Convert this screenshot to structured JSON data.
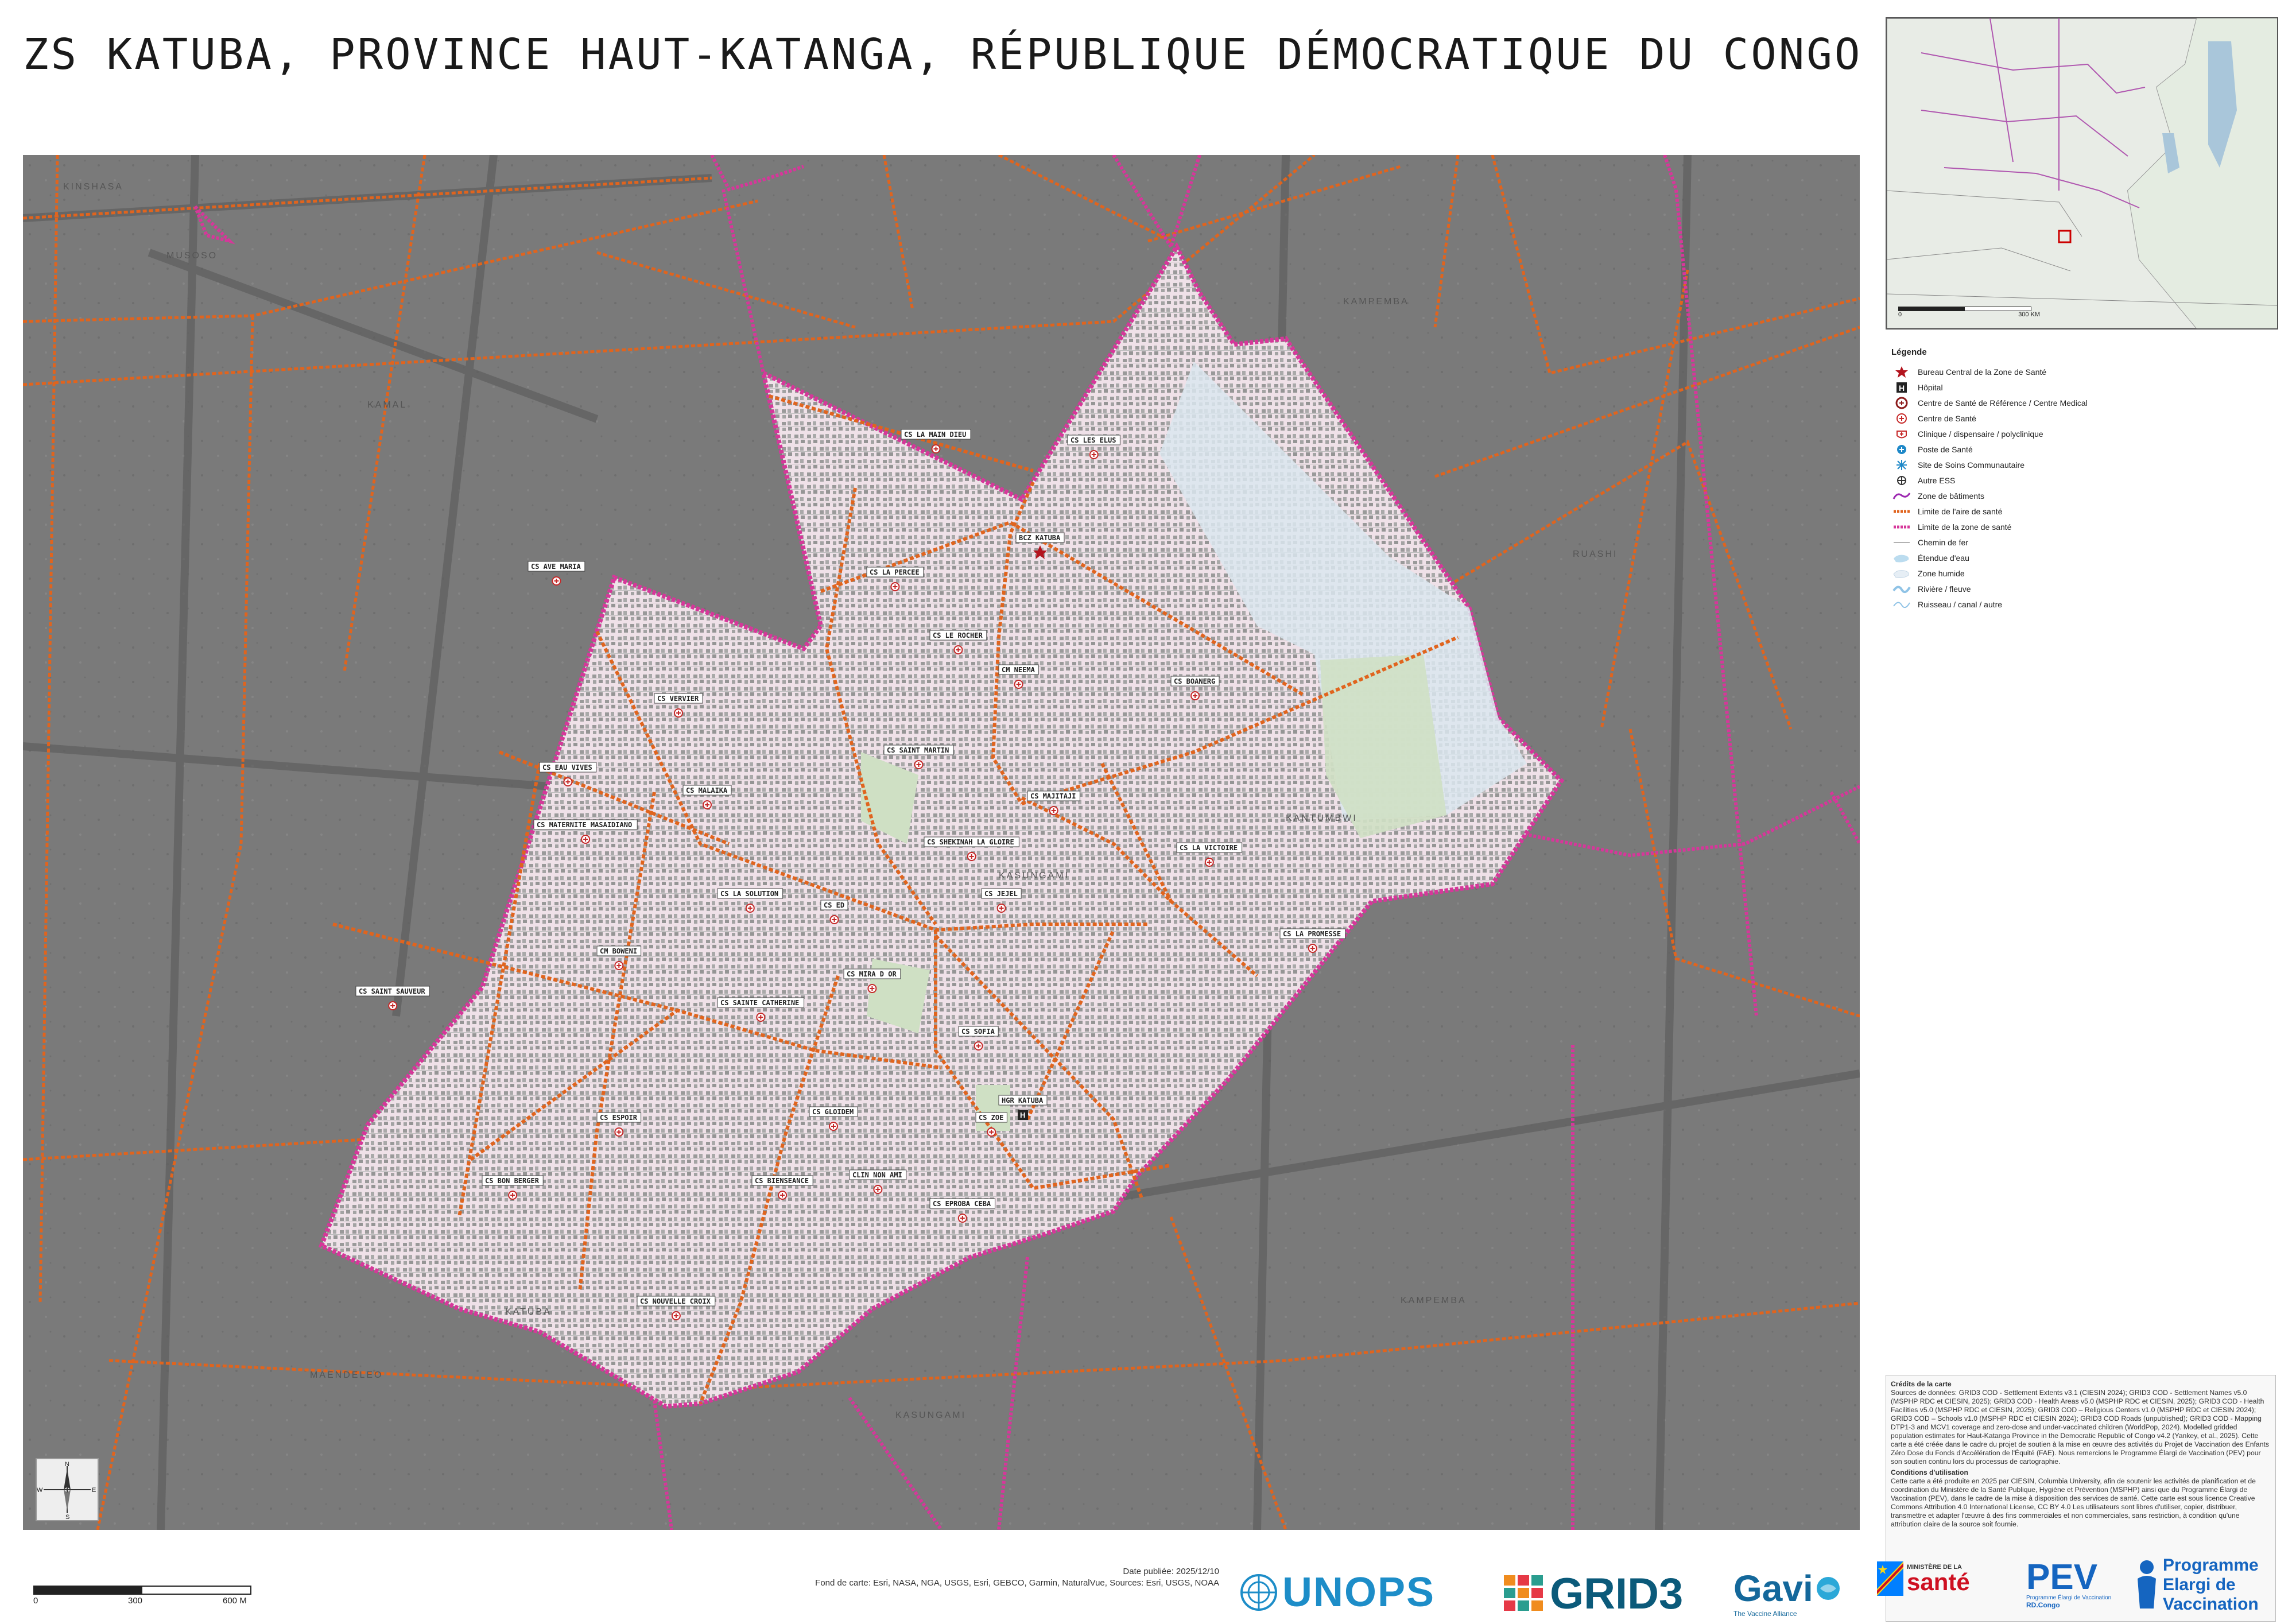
{
  "title": "ZS KATUBA, PROVINCE HAUT-KATANGA, RÉPUBLIQUE DÉMOCRATIQUE DU CONGO",
  "colors": {
    "health_zone_boundary": "#d6379a",
    "health_area_boundary": "#e0641e",
    "zone_fill": "#efe1e8",
    "background": "#7b7b7b",
    "wet_zone": "#dbe6ef",
    "green_space": "#cfe0c4"
  },
  "map": {
    "zone_label": "KATUBA",
    "place_label": "KANTUMBWI",
    "health_facilities": [
      {
        "label": "CS LA MAIN DIEU",
        "type": "centre-de-sante"
      },
      {
        "label": "CS LES ELUS",
        "type": "centre-de-sante"
      },
      {
        "label": "BCZ KATUBA",
        "type": "bureau-central"
      },
      {
        "label": "CS LA PERCEE",
        "type": "centre-de-sante"
      },
      {
        "label": "CS LE ROCHER",
        "type": "centre-de-sante"
      },
      {
        "label": "CM NEEMA",
        "type": "centre-de-sante"
      },
      {
        "label": "CS BOANERG",
        "type": "centre-de-sante"
      },
      {
        "label": "CS VERVIER",
        "type": "centre-de-sante"
      },
      {
        "label": "CS SAINT MARTIN",
        "type": "centre-de-sante"
      },
      {
        "label": "CS EAU VIVES",
        "type": "centre-de-sante"
      },
      {
        "label": "CS MALAIKA",
        "type": "centre-de-sante"
      },
      {
        "label": "CS MAJITAJI",
        "type": "centre-de-sante"
      },
      {
        "label": "CS MATERNITE MASAIDIANO",
        "type": "centre-de-sante"
      },
      {
        "label": "CS SHEKINAH LA GLOIRE",
        "type": "centre-de-sante"
      },
      {
        "label": "CS LA VICTOIRE",
        "type": "centre-de-sante"
      },
      {
        "label": "CS LA SOLUTION",
        "type": "centre-de-sante"
      },
      {
        "label": "CS JEJEL",
        "type": "centre-de-sante"
      },
      {
        "label": "CS ED",
        "type": "centre-de-sante"
      },
      {
        "label": "CS LA PROMESSE",
        "type": "centre-de-sante"
      },
      {
        "label": "CM BOWENI",
        "type": "centre-de-sante"
      },
      {
        "label": "CS MIRA D OR",
        "type": "centre-de-sante"
      },
      {
        "label": "CS SAINT SAUVEUR",
        "type": "centre-de-sante"
      },
      {
        "label": "CS SAINTE CATHERINE",
        "type": "centre-de-sante"
      },
      {
        "label": "CS SOFIA",
        "type": "centre-de-sante"
      },
      {
        "label": "HGR KATUBA",
        "type": "hopital"
      },
      {
        "label": "CS ESPOIR",
        "type": "centre-de-sante"
      },
      {
        "label": "CS GLOIDEM",
        "type": "centre-de-sante"
      },
      {
        "label": "CS ZOE",
        "type": "centre-de-sante"
      },
      {
        "label": "CS BON BERGER",
        "type": "centre-de-sante"
      },
      {
        "label": "CS BIENSEANCE",
        "type": "centre-de-sante"
      },
      {
        "label": "CLIN NON AMI",
        "type": "centre-de-sante"
      },
      {
        "label": "CS EPROBA CEBA",
        "type": "centre-de-sante"
      },
      {
        "label": "CS NOUVELLE CROIX",
        "type": "centre-de-sante"
      },
      {
        "label": "CS AVE MARIA",
        "type": "centre-de-sante"
      }
    ],
    "background_roads": [
      "KINSHASA",
      "KAMAL",
      "MUSOSO",
      "KASUNGAMI",
      "KAMPEMBA",
      "RUASHI",
      "KAMPEMBA",
      "MAENDELEO",
      "KASUNGAMI"
    ]
  },
  "inset": {
    "scale_start": "0",
    "scale_end": "300 KM"
  },
  "legend": {
    "title": "Légende",
    "items": [
      {
        "label": "Bureau Central de la Zone de Santé",
        "symbol": "star"
      },
      {
        "label": "Hôpital",
        "symbol": "hospital"
      },
      {
        "label": "Centre de Santé de Référence / Centre Medical",
        "symbol": "csr"
      },
      {
        "label": "Centre de Santé",
        "symbol": "cs"
      },
      {
        "label": "Clinique / dispensaire / polyclinique",
        "symbol": "clinic"
      },
      {
        "label": "Poste de Santé",
        "symbol": "ps"
      },
      {
        "label": "Site de Soins Communautaire",
        "symbol": "ssc"
      },
      {
        "label": "Autre ESS",
        "symbol": "other"
      },
      {
        "label": "Zone de bâtiments",
        "symbol": "buildings"
      },
      {
        "label": "Limite de l'aire de santé",
        "symbol": "area-limit"
      },
      {
        "label": "Limite de la zone de santé",
        "symbol": "zone-limit"
      },
      {
        "label": "Chemin de fer",
        "symbol": "rail"
      },
      {
        "label": "Étendue d'eau",
        "symbol": "water"
      },
      {
        "label": "Zone humide",
        "symbol": "wet"
      },
      {
        "label": "Rivière / fleuve",
        "symbol": "river"
      },
      {
        "label": "Ruisseau / canal / autre",
        "symbol": "stream"
      }
    ]
  },
  "credits": {
    "heading": "Crédits de la carte",
    "text": "Sources de données: GRID3 COD - Settlement Extents v3.1 (CIESIN 2024); GRID3 COD - Settlement Names v5.0 (MSPHP RDC et CIESIN, 2025); GRID3 COD - Health Areas v5.0 (MSPHP RDC et CIESIN, 2025); GRID3 COD - Health Facilities v5.0 (MSPHP RDC et CIESIN, 2025); GRID3 COD – Religious Centers v1.0 (MSPHP RDC et CIESIN 2024); GRID3 COD – Schools v1.0 (MSPHP RDC et CIESIN 2024); GRID3 COD Roads (unpublished); GRID3 COD - Mapping DTP1-3 and MCV1 coverage and zero-dose and under-vaccinated children (WorldPop, 2024). Modelled gridded population estimates for Haut-Katanga Province in the Democratic Republic of Congo v4.2 (Yankey, et al., 2025). Cette carte a été créée dans le cadre du projet de soutien à la mise en œuvre des activités du Projet de Vaccination des Enfants Zéro Dose du Fonds d'Accélération de l'Équité (FAE). Nous remercions le Programme Élargi de Vaccination (PEV) pour son soutien continu lors du processus de cartographie.",
    "conditions_heading": "Conditions d'utilisation",
    "conditions": "Cette carte a été produite en 2025 par CIESIN, Columbia University, afin de soutenir les activités de planification et de coordination du Ministère de la Santé Publique, Hygiène et Prévention (MSPHP) ainsi que du Programme Élargi de Vaccination (PEV), dans le cadre de la mise à disposition des services de santé. Cette carte est sous licence Creative Commons Attribution 4.0 International License, CC BY 4.0 Les utilisateurs sont libres d'utiliser, copier, distribuer, transmettre et adapter l'œuvre à des fins commerciales et non commerciales, sans restriction, à condition qu'une attribution claire de la source soit fournie."
  },
  "scale": {
    "start": "0",
    "mid": "300",
    "end": "600 M"
  },
  "footer": {
    "date": "Date publiée: 2025/12/10",
    "basemap": "Fond de carte: Esri, NASA, NGA, USGS, Esri, GEBCO, Garmin, NaturalVue, Sources: Esri, USGS, NOAA"
  },
  "logos": {
    "unops": "UNOPS",
    "grid3": "GRID3",
    "gavi": "Gavi",
    "gavi_sub": "The Vaccine Alliance",
    "ministry_top": "MINISTÈRE DE LA",
    "ministry": "santé",
    "pev": "PEV",
    "pev_sub1": "Programme Élargi de Vaccination",
    "pev_sub2": "RD.Congo",
    "programme": "Programme",
    "elargi": "Elargi de",
    "vaccination": "Vaccination"
  },
  "compass": {
    "n": "N",
    "s": "S",
    "e": "E",
    "w": "W"
  }
}
